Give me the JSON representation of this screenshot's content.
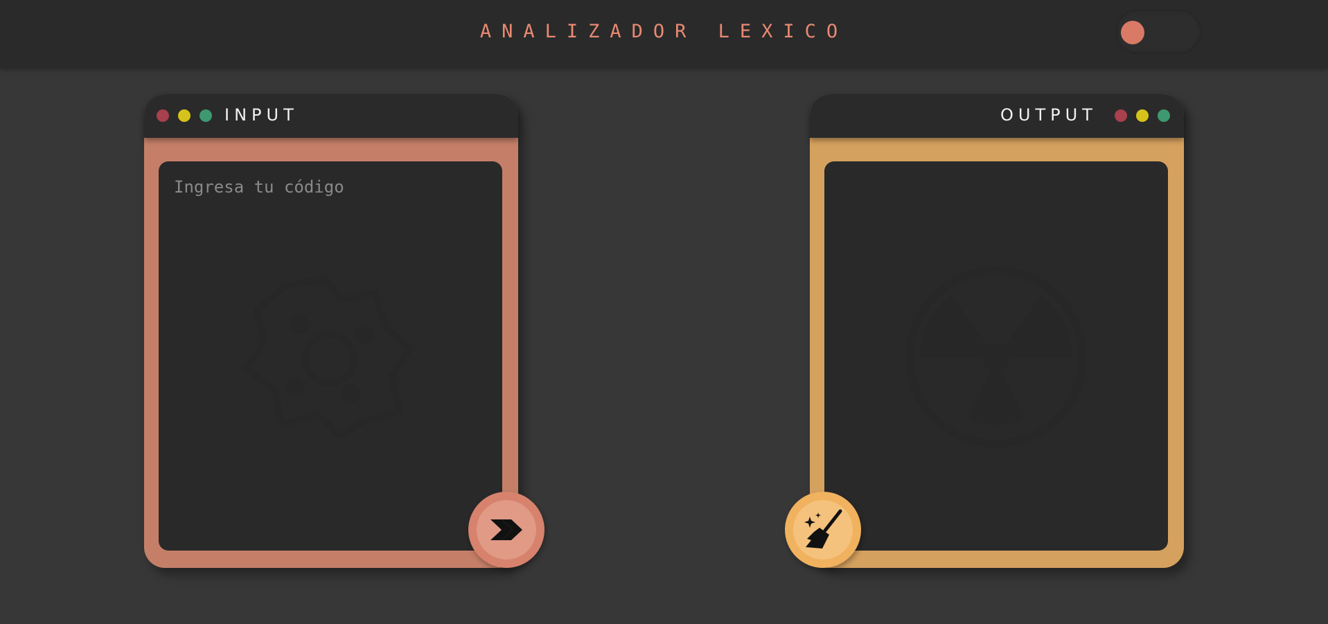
{
  "header": {
    "title": "ANALIZADOR LEXICO",
    "theme_toggle": {
      "state": "off",
      "knob_color": "#d97a66"
    }
  },
  "input_panel": {
    "label": "INPUT",
    "accent": "#c57f69",
    "window_dots": [
      "#a8404d",
      "#d5c31c",
      "#3e9970"
    ],
    "editor": {
      "value": "",
      "placeholder": "Ingresa tu código"
    },
    "action_button": {
      "icon": "double-chevron-right-icon",
      "color": "#e09a85"
    }
  },
  "output_panel": {
    "label": "OUTPUT",
    "accent": "#d5a15f",
    "window_dots": [
      "#a8404d",
      "#d5c31c",
      "#3e9970"
    ],
    "result": "",
    "action_button": {
      "icon": "broom-icon",
      "color": "#f5c27d"
    }
  }
}
